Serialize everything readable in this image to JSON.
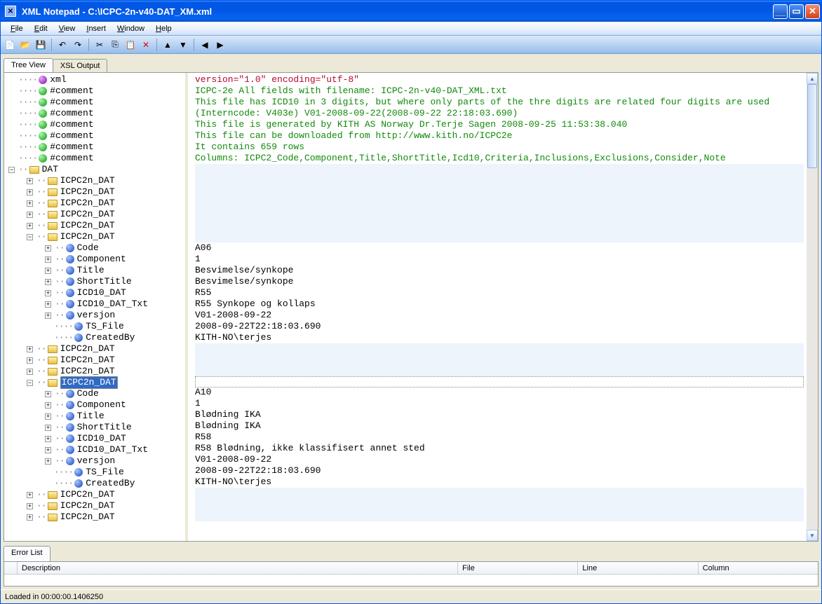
{
  "window": {
    "app_name": "XML Notepad",
    "file_path": "C:\\ICPC-2n-v40-DAT_XM.xml"
  },
  "menu": {
    "file": "File",
    "edit": "Edit",
    "view": "View",
    "insert": "Insert",
    "window": "Window",
    "help": "Help"
  },
  "tabs": {
    "tree_view": "Tree View",
    "xsl_output": "XSL Output"
  },
  "tree": {
    "xml": "xml",
    "comment": "#comment",
    "dat": "DAT",
    "child": "ICPC2n_DAT",
    "attrs": {
      "code": "Code",
      "component": "Component",
      "title": "Title",
      "short_title": "ShortTitle",
      "icd10_dat": "ICD10_DAT",
      "icd10_dat_txt": "ICD10_DAT_Txt",
      "versjon": "versjon",
      "ts_file": "TS_File",
      "created_by": "CreatedBy"
    }
  },
  "values": {
    "xml_decl": "version=\"1.0\" encoding=\"utf-8\"",
    "c1": "ICPC-2e  All fields with filename: ICPC-2n-v40-DAT_XML.txt",
    "c2": "This file has ICD10 in 3 digits, but where only parts of the thre digits are related four digits are used",
    "c3": "(Interncode: V403e) V01-2008-09-22(2008-09-22 22:18:03.690)",
    "c4": "This file is generated by KITH AS  Norway Dr.Terje Sagen 2008-09-25 11:53:38.040",
    "c5": "This file can be downloaded from http://www.kith.no/ICPC2e",
    "c6": "It contains 659 rows",
    "c7": "Columns: ICPC2_Code,Component,Title,ShortTitle,Icd10,Criteria,Inclusions,Exclusions,Consider,Note",
    "n1": {
      "code": "A06",
      "component": "1",
      "title": "Besvimelse/synkope",
      "short_title": "Besvimelse/synkope",
      "icd10_dat": "R55",
      "icd10_dat_txt": "R55 Synkope og kollaps",
      "versjon": "V01-2008-09-22",
      "ts_file": "2008-09-22T22:18:03.690",
      "created_by": "KITH-NO\\terjes"
    },
    "n2": {
      "code": "A10",
      "component": "1",
      "title": "Blødning IKA",
      "short_title": "Blødning IKA",
      "icd10_dat": "R58",
      "icd10_dat_txt": "R58 Blødning, ikke klassifisert annet sted",
      "versjon": "V01-2008-09-22",
      "ts_file": "2008-09-22T22:18:03.690",
      "created_by": "KITH-NO\\terjes"
    }
  },
  "errors": {
    "tab": "Error List",
    "col_description": "Description",
    "col_file": "File",
    "col_line": "Line",
    "col_column": "Column"
  },
  "status": {
    "text": "Loaded in 00:00:00.1406250"
  }
}
